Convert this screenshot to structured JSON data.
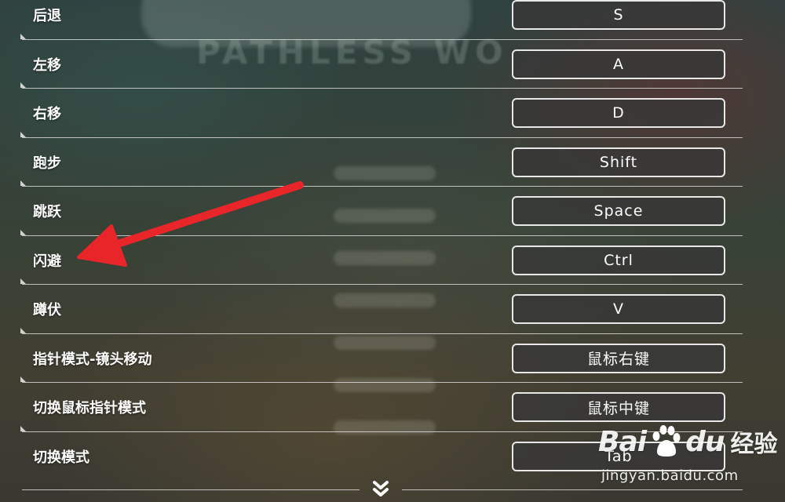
{
  "background": {
    "title_text": "PATHLESS WO",
    "menu_items": [
      "",
      "",
      "",
      "",
      "",
      "",
      ""
    ]
  },
  "bindings": [
    {
      "action": "后退",
      "key": "S"
    },
    {
      "action": "左移",
      "key": "A"
    },
    {
      "action": "右移",
      "key": "D"
    },
    {
      "action": "跑步",
      "key": "Shift"
    },
    {
      "action": "跳跃",
      "key": "Space"
    },
    {
      "action": "闪避",
      "key": "Ctrl"
    },
    {
      "action": "蹲伏",
      "key": "V"
    },
    {
      "action": "指针模式-镜头移动",
      "key": "鼠标右键"
    },
    {
      "action": "切换鼠标指针模式",
      "key": "鼠标中键"
    },
    {
      "action": "切换模式",
      "key": "Tab"
    }
  ],
  "scroll_indicator": {
    "icon": "chevron-down-icon"
  },
  "annotation": {
    "color": "#e8262a",
    "points_to": "闪避"
  },
  "watermark": {
    "bai": "Bai",
    "du": "du",
    "jingyan": "经验",
    "url": "jingyan.baidu.com"
  },
  "colors": {
    "label": "#ffffff",
    "button_border": "#e8e8e8",
    "button_bg": "#373737",
    "divider": "#ebebeb",
    "arrow": "#e8262a"
  }
}
